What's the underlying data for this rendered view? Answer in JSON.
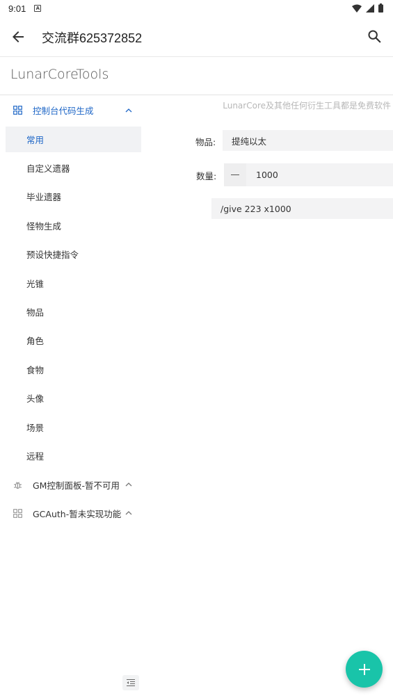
{
  "status_bar": {
    "time": "9:01",
    "notification_icon": "A"
  },
  "app_bar": {
    "title": "交流群625372852"
  },
  "brand": "LunarCoreTools",
  "notice": "LunarCore及其他任何衍生工具都是免费软件",
  "sidebar": {
    "console_group": {
      "label": "控制台代码生成",
      "items": [
        {
          "label": "常用"
        },
        {
          "label": "自定义遗器"
        },
        {
          "label": "毕业遗器"
        },
        {
          "label": "怪物生成"
        },
        {
          "label": "预设快捷指令"
        },
        {
          "label": "光锥"
        },
        {
          "label": "物品"
        },
        {
          "label": "角色"
        },
        {
          "label": "食物"
        },
        {
          "label": "头像"
        },
        {
          "label": "场景"
        },
        {
          "label": "远程"
        }
      ]
    },
    "gm_group": {
      "label": "GM控制面板-暂不可用"
    },
    "gcauth_group": {
      "label": "GCAuth-暂未实现功能"
    }
  },
  "form": {
    "item_label": "物品:",
    "item_value": "提纯以太",
    "quantity_label": "数量:",
    "quantity_value": "1000",
    "command": "/give 223 x1000"
  },
  "colors": {
    "accent": "#1f67c7",
    "fab": "#19c4a9",
    "selected_bg": "#f1f2f4"
  },
  "icons": {
    "back": "arrow-left-icon",
    "search": "search-icon",
    "console": "grid-icon",
    "gm": "bug-icon",
    "gcauth": "grid-icon",
    "fab": "plus-icon",
    "collapse": "menu-fold-icon"
  }
}
